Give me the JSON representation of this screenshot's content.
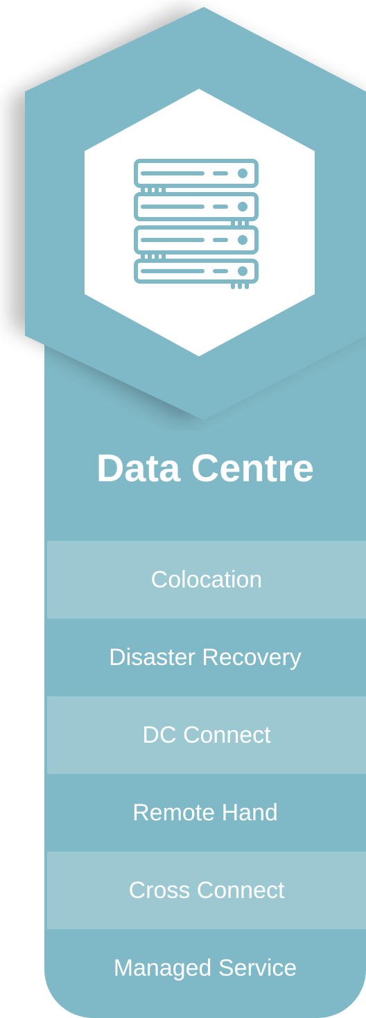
{
  "card": {
    "title": "Data Centre",
    "icon": "server-rack-icon"
  },
  "menu": {
    "items": [
      {
        "label": "Colocation"
      },
      {
        "label": "Disaster Recovery"
      },
      {
        "label": "DC Connect"
      },
      {
        "label": "Remote Hand"
      },
      {
        "label": "Cross Connect"
      },
      {
        "label": "Managed Service"
      }
    ]
  },
  "colors": {
    "card": "#7fb8c6",
    "hexagon": "#7fb8c6",
    "row_light": "#9cc8d2",
    "icon_stroke": "#7fb8c6",
    "text": "#ffffff"
  }
}
